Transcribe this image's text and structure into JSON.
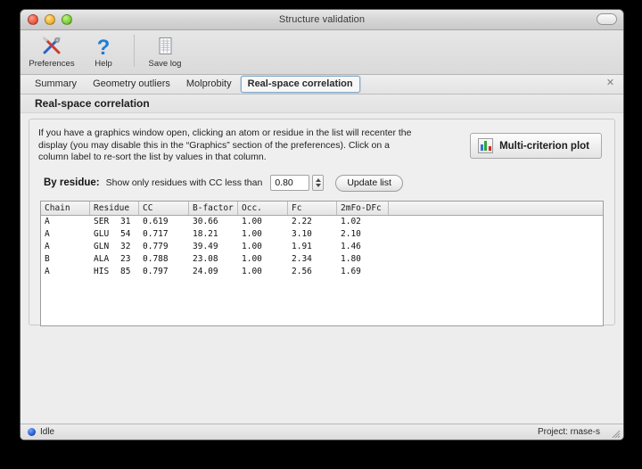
{
  "window": {
    "title": "Structure validation",
    "controls": {
      "close": "close-button",
      "minimize": "minimize-button",
      "zoom": "zoom-button",
      "toolbar_toggle": "toolbar-toggle-button"
    }
  },
  "toolbar": {
    "items": [
      {
        "label": "Preferences",
        "icon": "preferences-tools-icon"
      },
      {
        "label": "Help",
        "icon": "help-question-icon"
      },
      {
        "label": "Save log",
        "icon": "save-log-document-icon"
      }
    ]
  },
  "tabs": {
    "items": [
      {
        "label": "Summary",
        "selected": false
      },
      {
        "label": "Geometry outliers",
        "selected": false
      },
      {
        "label": "Molprobity",
        "selected": false
      },
      {
        "label": "Real-space correlation",
        "selected": true
      }
    ],
    "close_label": "✕"
  },
  "section": {
    "heading": "Real-space correlation",
    "description": "If you have a graphics window open, clicking an atom or residue in the list will recenter the display (you may disable this in the “Graphics” section of the preferences).  Click on a column label to re-sort the list by values in that column."
  },
  "multi_criterion_button": {
    "label": "Multi-criterion plot",
    "icon": "bar-chart-icon",
    "bar_colors": [
      "#3a6fd8",
      "#2fa53c",
      "#cf2a23"
    ]
  },
  "filter": {
    "title": "By residue:",
    "text": "Show only residues with CC less than",
    "cc_value": "0.80",
    "cc_placeholder": "0.80",
    "update_label": "Update list"
  },
  "table": {
    "columns": [
      "Chain",
      "Residue",
      "CC",
      "B-factor",
      "Occ.",
      "Fc",
      "2mFo-DFc",
      ""
    ],
    "rows": [
      {
        "chain": "A",
        "residue_name": "SER",
        "residue_number": "31",
        "cc": "0.619",
        "b_factor": "30.66",
        "occ": "1.00",
        "fc": "2.22",
        "two_mfo_dfc": "1.02"
      },
      {
        "chain": "A",
        "residue_name": "GLU",
        "residue_number": "54",
        "cc": "0.717",
        "b_factor": "18.21",
        "occ": "1.00",
        "fc": "3.10",
        "two_mfo_dfc": "2.10"
      },
      {
        "chain": "A",
        "residue_name": "GLN",
        "residue_number": "32",
        "cc": "0.779",
        "b_factor": "39.49",
        "occ": "1.00",
        "fc": "1.91",
        "two_mfo_dfc": "1.46"
      },
      {
        "chain": "B",
        "residue_name": "ALA",
        "residue_number": "23",
        "cc": "0.788",
        "b_factor": "23.08",
        "occ": "1.00",
        "fc": "2.34",
        "two_mfo_dfc": "1.80"
      },
      {
        "chain": "A",
        "residue_name": "HIS",
        "residue_number": "85",
        "cc": "0.797",
        "b_factor": "24.09",
        "occ": "1.00",
        "fc": "2.56",
        "two_mfo_dfc": "1.69"
      }
    ]
  },
  "statusbar": {
    "status": "Idle",
    "status_color": "#2b5fd8",
    "project": "Project: rnase-s"
  }
}
